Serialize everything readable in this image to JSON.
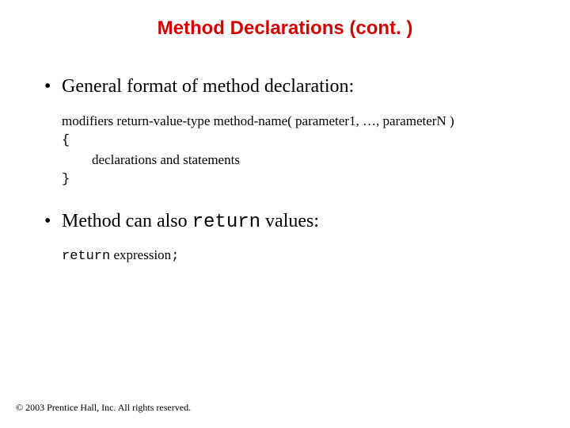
{
  "title": "Method Declarations (cont. )",
  "bullets": {
    "b1": "General format of method declaration:",
    "b2_pre": "Method can also ",
    "b2_mono": "return",
    "b2_post": " values:"
  },
  "code": {
    "sig": "modifiers return-value-type  method-name( parameter1, …, parameterN  )",
    "open": "{",
    "body": "declarations and statements",
    "close": "}"
  },
  "ret": {
    "kw": "return",
    "rest": " expression",
    "semi": ";"
  },
  "footer": "© 2003 Prentice Hall, Inc. All rights reserved."
}
